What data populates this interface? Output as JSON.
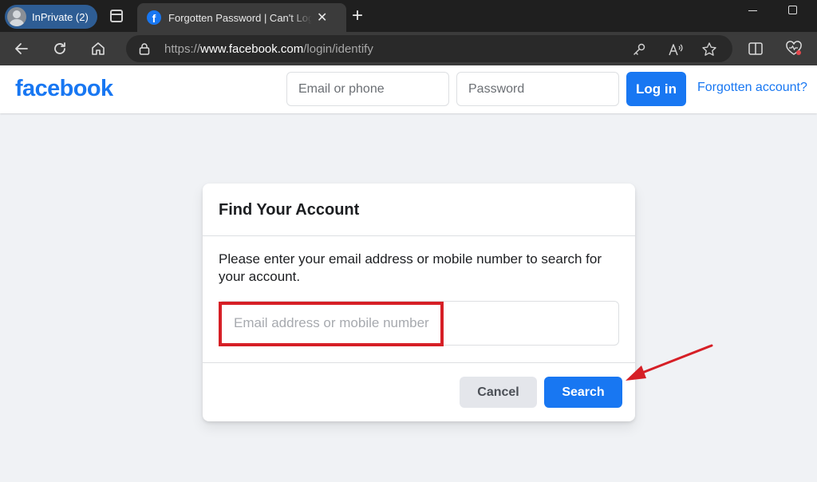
{
  "browser": {
    "profile_label": "InPrivate (2)",
    "tab_title": "Forgotten Password | Can't Log In",
    "tab_close": "✕",
    "new_tab": "+",
    "url_prefix": "https://",
    "url_host": "www.facebook.com",
    "url_path": "/login/identify"
  },
  "header": {
    "logo": "facebook",
    "email_placeholder": "Email or phone",
    "password_placeholder": "Password",
    "login_label": "Log in",
    "forgot_label": "Forgotten account?"
  },
  "card": {
    "title": "Find Your Account",
    "instructions": "Please enter your email address or mobile number to search for your account.",
    "input_placeholder": "Email address or mobile number",
    "cancel_label": "Cancel",
    "search_label": "Search"
  },
  "colors": {
    "brand": "#1877f2",
    "annotation": "#d61f26",
    "page_bg": "#f0f2f5"
  }
}
